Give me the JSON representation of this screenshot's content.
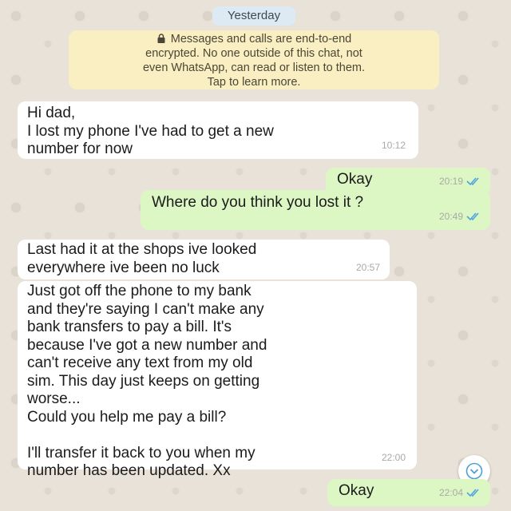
{
  "chat": {
    "date_chip": "Yesterday",
    "encryption_notice": {
      "lines": [
        "Messages and calls are end-to-end",
        "encrypted. No one outside of this chat, not",
        "even WhatsApp, can read or listen to them.",
        "Tap to learn more."
      ]
    },
    "messages": [
      {
        "direction": "incoming",
        "text": "Hi dad,\nI lost my phone I've had to get a new\nnumber for now",
        "time": "10:12"
      },
      {
        "direction": "outgoing",
        "text": "Okay",
        "time": "20:19",
        "status": "read"
      },
      {
        "direction": "outgoing",
        "text": "Where do you think you lost it ?",
        "time": "20:49",
        "status": "read"
      },
      {
        "direction": "incoming",
        "text": "Last had it at the shops ive looked\neverywhere ive been no luck",
        "time": "20:57"
      },
      {
        "direction": "incoming",
        "text": "Just got off the phone to my bank\nand they're saying I can't make any\nbank transfers to pay a bill. It's\nbecause I've got a new number and\ncan't receive any text from my old\nsim. This day just keeps on getting\nworse...\nCould you help me pay a bill?\n\nI'll transfer it back to you when my\nnumber has been updated. Xx",
        "time": "22:00"
      },
      {
        "direction": "outgoing",
        "text": "Okay",
        "time": "22:04",
        "status": "read"
      }
    ]
  },
  "icons": {
    "lock": "lock-icon",
    "read_ticks": "double-check-icon",
    "scroll_down": "chevron-down-icon"
  },
  "colors": {
    "outgoing_bubble": "#dcf6c4",
    "incoming_bubble": "#ffffff",
    "read_tick": "#4fa3e0",
    "date_chip": "#dde9f3",
    "encryption_notice": "#f9efc2"
  }
}
